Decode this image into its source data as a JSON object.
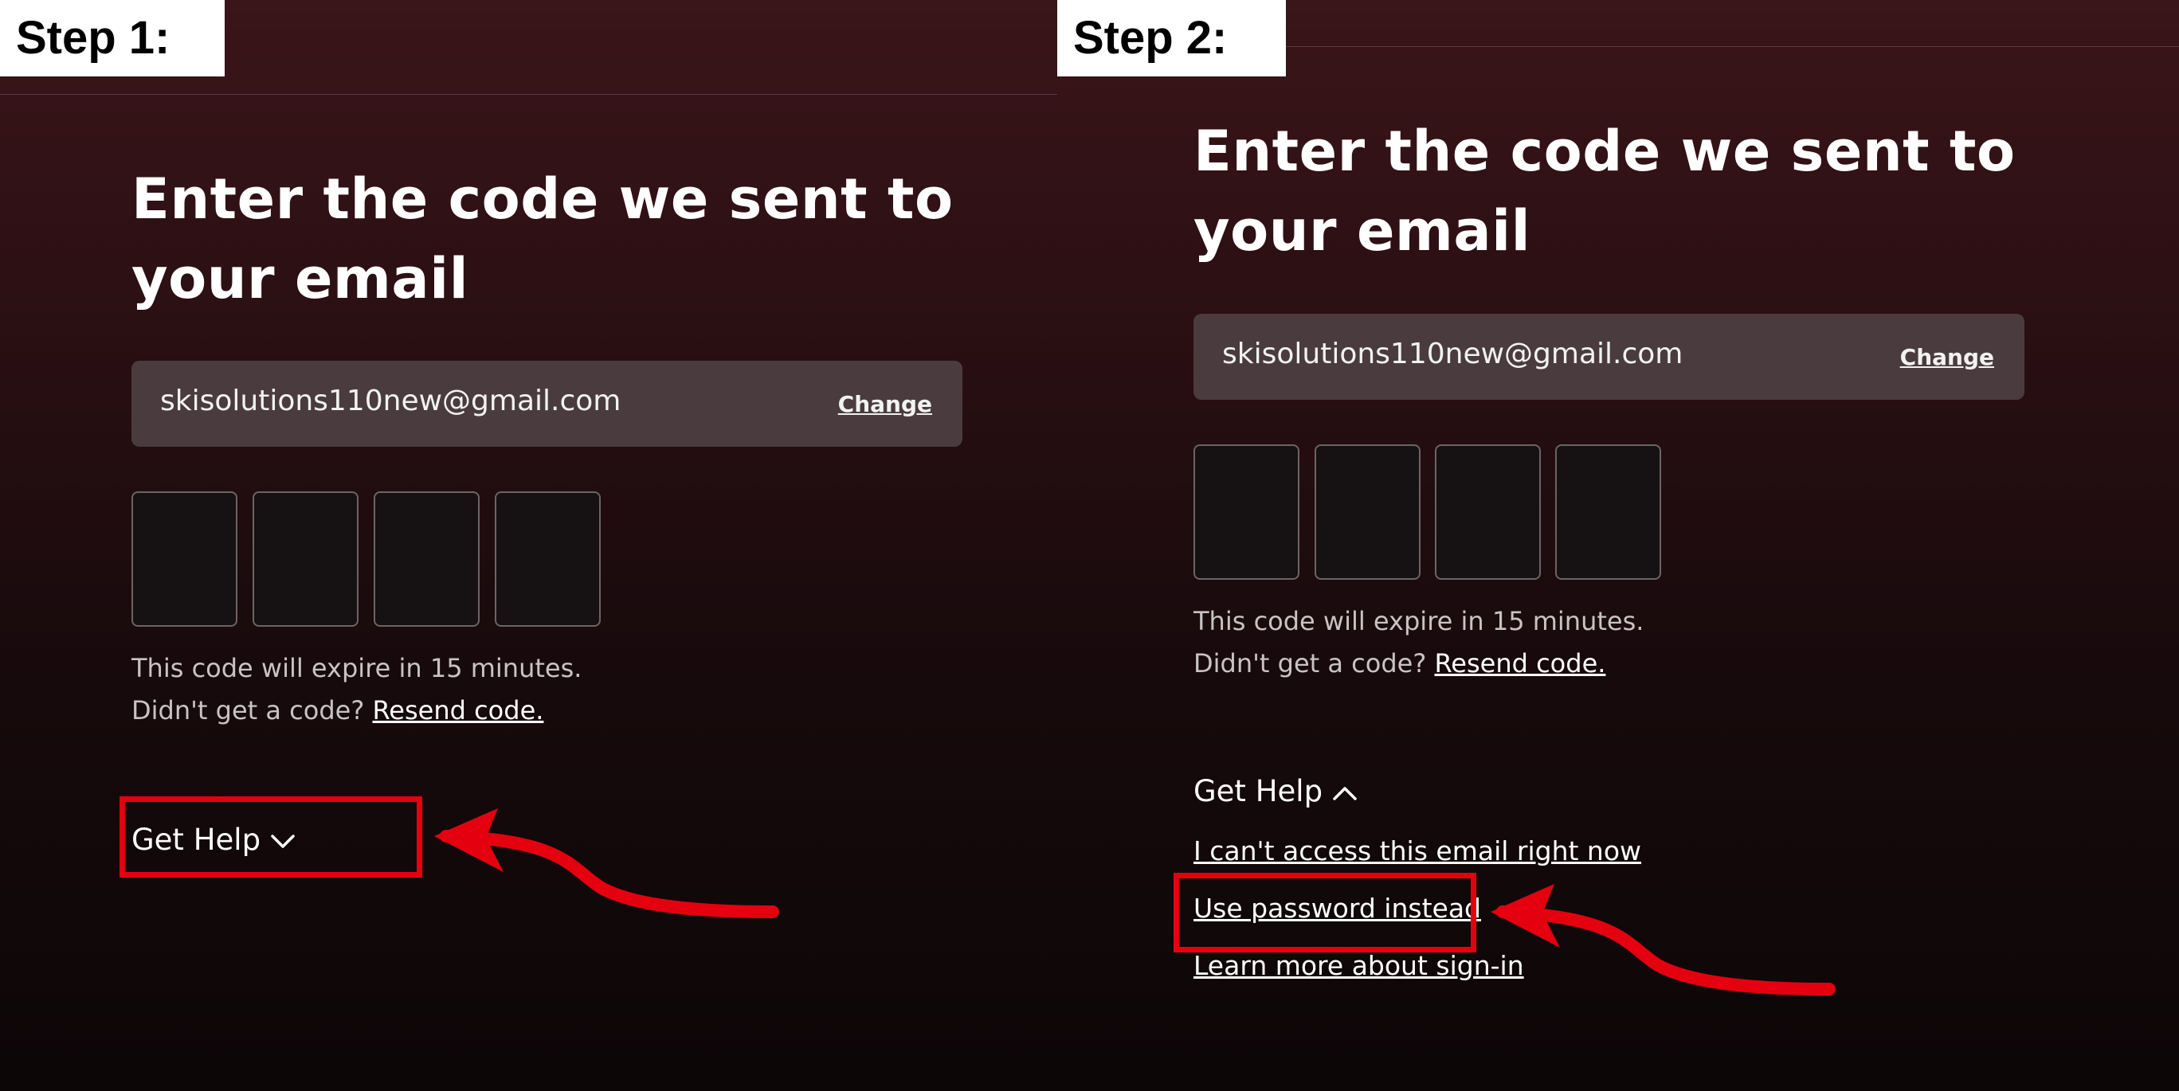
{
  "colors": {
    "accent_red": "#e4000f",
    "email_box": "#4a3c3e"
  },
  "steps": [
    {
      "label": "Step 1:",
      "title_line1": "Enter the code we sent to",
      "title_line2": "your email",
      "email": "skisolutions110new@gmail.com",
      "change_label": "Change",
      "code_digits": 4,
      "expire_text": "This code will expire in 15 minutes.",
      "resend_prompt": "Didn't get a code?",
      "resend_link": "Resend code.",
      "help_label": "Get Help",
      "help_icon": "chevron-down-icon"
    },
    {
      "label": "Step 2:",
      "title_line1": "Enter the code we sent to",
      "title_line2": "your email",
      "email": "skisolutions110new@gmail.com",
      "change_label": "Change",
      "code_digits": 4,
      "expire_text": "This code will expire in 15 minutes.",
      "resend_prompt": "Didn't get a code?",
      "resend_link": "Resend code.",
      "help_label": "Get Help",
      "help_icon": "chevron-up-icon",
      "help_options": [
        "I can't access this email right now",
        "Use password instead",
        "Learn more about sign-in"
      ]
    }
  ]
}
